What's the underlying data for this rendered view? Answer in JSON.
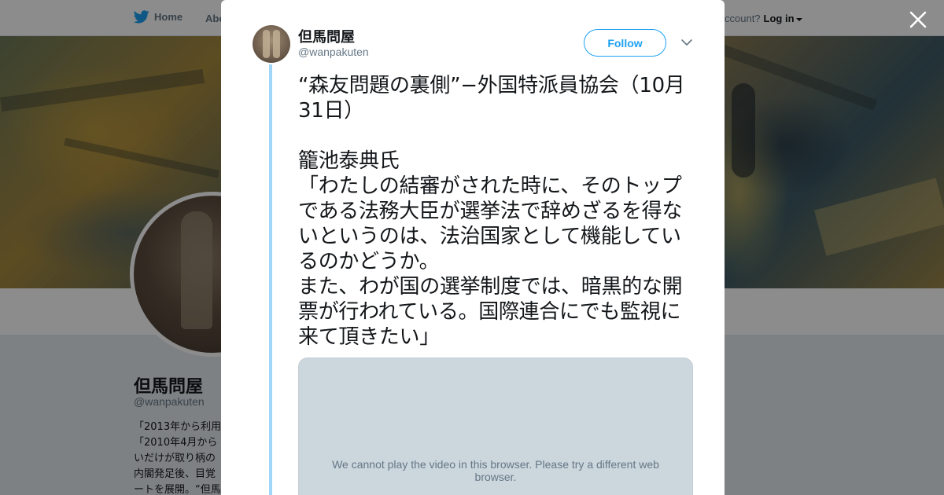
{
  "nav": {
    "home_label": "Home",
    "about_label": "Abo",
    "account_prompt": "ccount?",
    "login_label": "Log in"
  },
  "profile": {
    "name": "但馬問屋",
    "handle": "@wanpakuten",
    "bio_lines": [
      "「2013年から利用",
      "「2010年4月から",
      "いだけが取り柄の",
      "内閣発足後、目覚",
      "ートを展開。“但馬"
    ]
  },
  "tweet": {
    "author_name": "但馬問屋",
    "author_handle": "@wanpakuten",
    "follow_label": "Follow",
    "text": "“森友問題の裏側”−外国特派員協会（10月31日）\n\n籠池泰典氏\n「わたしの結審がされた時に、そのトップである法務大臣が選挙法で辞めざるを得ないというのは、法治国家として機能しているのかどうか。\nまた、わが国の選挙制度では、暗黒的な開票が行われている。国際連合にでも監視に来て頂きたい」",
    "video_message": "We cannot play the video in this browser. Please try a different web browser."
  },
  "colors": {
    "twitter_blue": "#1da1f2",
    "thread_line": "#a0d7f8",
    "overlay": "rgba(0,0,0,0.45)",
    "video_bg": "#ccd6dd"
  },
  "icons": [
    "twitter-bird-icon",
    "caret-down-icon",
    "close-icon",
    "chevron-down-icon"
  ]
}
